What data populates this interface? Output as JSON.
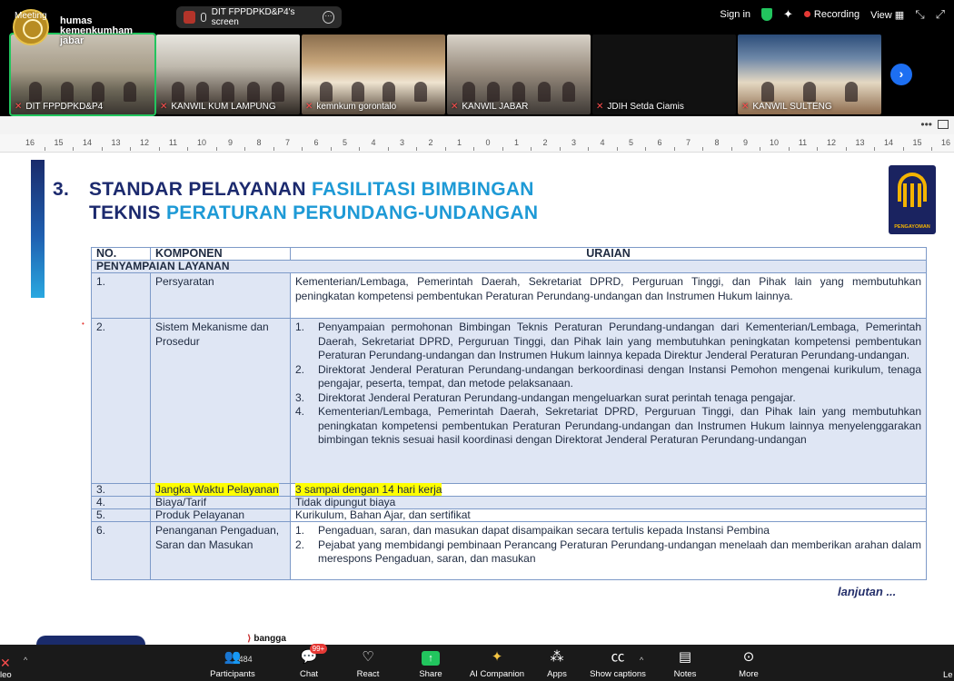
{
  "topbar": {
    "meeting_label": "Meeting",
    "org_name": "humas kemenkumham jabar",
    "share_pill_label": "DIT FPPDPKD&P4's screen",
    "sign_in": "Sign in",
    "recording": "Recording",
    "view": "View"
  },
  "tiles": [
    {
      "name": "DIT FPPDPKD&P4"
    },
    {
      "name": "KANWIL KUM LAMPUNG"
    },
    {
      "name": "kemnkum gorontalo"
    },
    {
      "name": "KANWIL JABAR"
    },
    {
      "name": "JDIH Setda Ciamis"
    },
    {
      "name": "KANWIL SULTENG"
    }
  ],
  "ruler": {
    "ticks": [
      "16",
      "15",
      "14",
      "13",
      "12",
      "11",
      "10",
      "9",
      "8",
      "7",
      "6",
      "5",
      "4",
      "3",
      "2",
      "1",
      "0",
      "1",
      "2",
      "3",
      "4",
      "5",
      "6",
      "7",
      "8",
      "9",
      "10",
      "11",
      "12",
      "13",
      "14",
      "15",
      "16"
    ]
  },
  "slide": {
    "title_num": "3.",
    "title_line1_a": "STANDAR PELAYANAN ",
    "title_line1_b": "FASILITASI BIMBINGAN",
    "title_line2_a": "TEKNIS ",
    "title_line2_b": "PERATURAN PERUNDANG-UNDANGAN",
    "emblem_text": "PENGAYOMAN",
    "table": {
      "headers": [
        "NO.",
        "KOMPONEN",
        "URAIAN"
      ],
      "section": "PENYAMPAIAN LAYANAN",
      "rows": [
        {
          "no": "1.",
          "komponen": "Persyaratan",
          "uraian": "Kementerian/Lembaga, Pemerintah Daerah, Sekretariat DPRD, Perguruan Tinggi, dan Pihak lain yang membutuhkan peningkatan kompetensi pembentukan Peraturan Perundang-undangan dan Instrumen Hukum lainnya."
        },
        {
          "no": "2.",
          "komponen": "Sistem Mekanisme dan Prosedur",
          "steps": [
            {
              "n": "1.",
              "t": "Penyampaian permohonan Bimbingan Teknis Peraturan Perundang-undangan dari Kementerian/Lembaga, Pemerintah Daerah, Sekretariat DPRD, Perguruan Tinggi, dan Pihak lain yang membutuhkan peningkatan kompetensi pembentukan Peraturan Perundang-undangan dan Instrumen Hukum lainnya kepada Direktur Jenderal Peraturan Perundang-undangan."
            },
            {
              "n": "2.",
              "t": "Direktorat Jenderal Peraturan Perundang-undangan berkoordinasi dengan Instansi Pemohon mengenai kurikulum, tenaga pengajar, peserta, tempat, dan metode pelaksanaan."
            },
            {
              "n": "3.",
              "t": "Direktorat Jenderal Peraturan Perundang-undangan mengeluarkan surat perintah tenaga pengajar."
            },
            {
              "n": "4.",
              "t": "Kementerian/Lembaga, Pemerintah Daerah, Sekretariat DPRD, Perguruan Tinggi, dan Pihak lain yang membutuhkan peningkatan kompetensi pembentukan Peraturan Perundang-undangan dan Instrumen Hukum lainnya menyelenggarakan bimbingan teknis sesuai hasil koordinasi dengan Direktorat Jenderal Peraturan Perundang-undangan"
            }
          ]
        },
        {
          "no": "3.",
          "komponen": "Jangka Waktu Pelayanan",
          "uraian": "3 sampai dengan 14 hari kerja"
        },
        {
          "no": "4.",
          "komponen": "Biaya/Tarif",
          "uraian": "Tidak dipungut biaya"
        },
        {
          "no": "5.",
          "komponen": "Produk Pelayanan",
          "uraian": "Kurikulum, Bahan Ajar, dan sertifikat"
        },
        {
          "no": "6.",
          "komponen": "Penanganan Pengaduan, Saran dan Masukan",
          "steps": [
            {
              "n": "1.",
              "t": "Pengaduan, saran, dan masukan dapat disampaikan secara tertulis kepada Instansi Pembina"
            },
            {
              "n": "2.",
              "t": "Pejabat yang membidangi pembinaan Perancang Peraturan Perundang-undangan menelaah dan memberikan arahan dalam merespons Pengaduan, saran, dan masukan"
            }
          ]
        }
      ]
    },
    "continue_label": "lanjutan ...",
    "bottom_logo_a": "bangga"
  },
  "toolbar": {
    "participants_count": "484",
    "chat_badge": "99+",
    "items": [
      "Participants",
      "Chat",
      "React",
      "Share",
      "AI Companion",
      "Apps",
      "Show captions",
      "Notes",
      "More"
    ],
    "left_edge": "leo",
    "right_edge": "Le"
  },
  "colors": {
    "title_dark": "#1c2a6e",
    "title_accent": "#1e9ad6",
    "table_border": "#7d9ac8",
    "table_shade": "#dfe6f4",
    "highlight": "#ffff00",
    "active_tile": "#22c55e",
    "recording_dot": "#e53935"
  }
}
